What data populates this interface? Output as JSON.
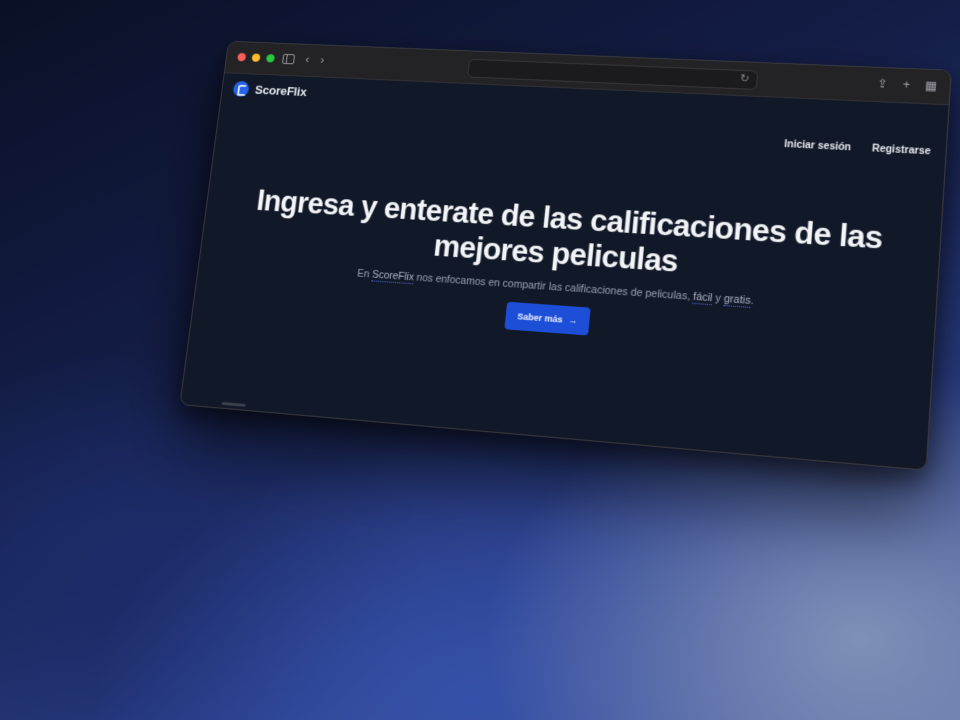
{
  "browser": {
    "controls": {
      "back_icon": "chevron-left-icon",
      "forward_icon": "chevron-right-icon",
      "sidebar_icon": "sidebar-icon"
    },
    "address_bar": {
      "value": "",
      "reload_icon": "reload-icon"
    },
    "toolbar_icons": [
      "share-icon",
      "new-tab-icon",
      "tab-overview-icon"
    ]
  },
  "header": {
    "brand": "ScoreFlix",
    "login": "Iniciar sesión",
    "register": "Registrarse"
  },
  "hero": {
    "title": "Ingresa y enterate de las calificaciones de las mejores peliculas",
    "subtitle_pre": "En ",
    "subtitle_brand": "ScoreFlix",
    "subtitle_mid": " nos enfocamos en compartir las calificaciones de peliculas, ",
    "subtitle_easy": "fácil",
    "subtitle_and": " y ",
    "subtitle_free": "gratis",
    "subtitle_end": ".",
    "cta_label": "Saber más"
  },
  "colors": {
    "page_bg": "#111827",
    "accent": "#1d4ed8",
    "brand_logo": "#2563eb"
  }
}
